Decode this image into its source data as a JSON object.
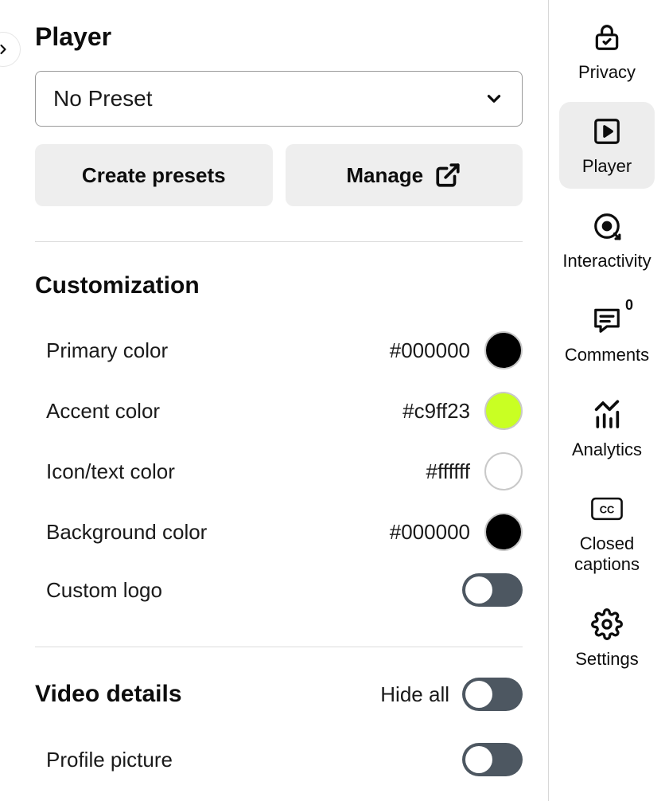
{
  "header": {
    "title": "Player"
  },
  "preset": {
    "selected": "No Preset",
    "create_label": "Create presets",
    "manage_label": "Manage"
  },
  "customization": {
    "title": "Customization",
    "primary": {
      "label": "Primary color",
      "value": "#000000",
      "swatch": "#000000"
    },
    "accent": {
      "label": "Accent color",
      "value": "#c9ff23",
      "swatch": "#c9ff23"
    },
    "icon_text": {
      "label": "Icon/text color",
      "value": "#ffffff",
      "swatch": "#ffffff"
    },
    "background": {
      "label": "Background color",
      "value": "#000000",
      "swatch": "#000000"
    },
    "custom_logo": {
      "label": "Custom logo"
    }
  },
  "video_details": {
    "title": "Video details",
    "hide_all_label": "Hide all",
    "profile_picture": {
      "label": "Profile picture"
    }
  },
  "sidebar": {
    "privacy": "Privacy",
    "player": "Player",
    "interactivity": "Interactivity",
    "comments": "Comments",
    "comments_count": "0",
    "analytics": "Analytics",
    "closed_captions": "Closed captions",
    "settings": "Settings"
  }
}
